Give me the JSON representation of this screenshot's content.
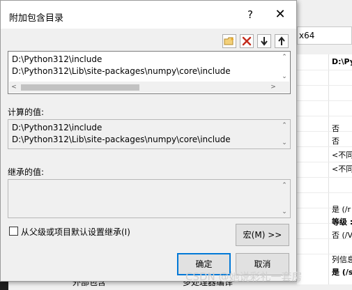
{
  "dialog": {
    "title": "附加包含目录",
    "help_label": "?",
    "close_label": "✕",
    "toolbar": {
      "new_line_icon": "new-line-icon",
      "delete_icon": "delete-icon",
      "move_down_icon": "arrow-down-icon",
      "move_up_icon": "arrow-up-icon"
    },
    "editable_paths": [
      "D:\\Python312\\include",
      "D:\\Python312\\Lib\\site-packages\\numpy\\core\\include"
    ],
    "evaluated_label": "计算的值:",
    "evaluated_paths": [
      "D:\\Python312\\include",
      "D:\\Python312\\Lib\\site-packages\\numpy\\core\\include"
    ],
    "inherited_label": "继承的值:",
    "inherit_checkbox_label": "从父级或项目默认设置继承(I)",
    "inherit_checked": false,
    "macros_button": "宏(M) >>",
    "ok_button": "确定",
    "cancel_button": "取消"
  },
  "background": {
    "toolbar_text": "x64",
    "grid_values": [
      "D:\\Py",
      "否",
      "否",
      "<不同",
      "<不同",
      "是 (/r",
      "等级 :",
      "否 (/V",
      "列信息",
      "是 (/s"
    ],
    "bottom_left": "外部包含",
    "bottom_right": "多处理器编译"
  },
  "watermark": "CSDN @她说彩礼一套房",
  "colors": {
    "accent": "#0078d7",
    "delete_red": "#c42b1c",
    "window_bg": "#f0f0f0"
  }
}
